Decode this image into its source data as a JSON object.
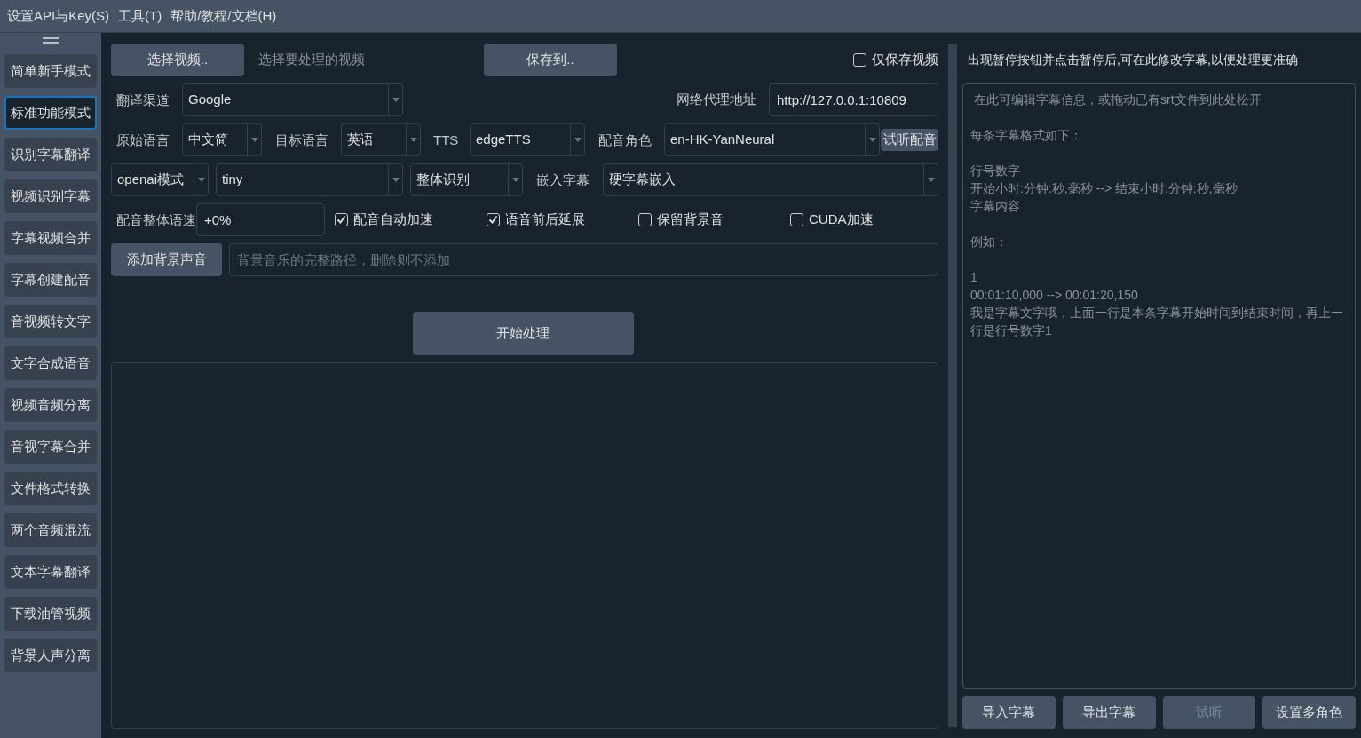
{
  "menu": [
    {
      "label": "设置API与Key(S)"
    },
    {
      "label": "工具(T)"
    },
    {
      "label": "帮助/教程/文档(H)"
    }
  ],
  "sidebar": {
    "items": [
      {
        "label": "简单新手模式",
        "selected": false
      },
      {
        "label": "标准功能模式",
        "selected": true
      },
      {
        "label": "识别字幕翻译",
        "selected": false
      },
      {
        "label": "视频识别字幕",
        "selected": false
      },
      {
        "label": "字幕视频合并",
        "selected": false
      },
      {
        "label": "字幕创建配音",
        "selected": false
      },
      {
        "label": "音视频转文字",
        "selected": false
      },
      {
        "label": "文字合成语音",
        "selected": false
      },
      {
        "label": "视频音频分离",
        "selected": false
      },
      {
        "label": "音视字幕合并",
        "selected": false
      },
      {
        "label": "文件格式转换",
        "selected": false
      },
      {
        "label": "两个音频混流",
        "selected": false
      },
      {
        "label": "文本字幕翻译",
        "selected": false
      },
      {
        "label": "下载油管视频",
        "selected": false
      },
      {
        "label": "背景人声分离",
        "selected": false
      }
    ]
  },
  "main": {
    "select_video_button": "选择视频..",
    "video_hint": "选择要处理的视频",
    "save_to_button": "保存到..",
    "only_save_video": {
      "label": "仅保存视频",
      "checked": false
    },
    "translation_channel": {
      "label": "翻译渠道",
      "value": "Google"
    },
    "proxy": {
      "label": "网络代理地址",
      "value": "http://127.0.0.1:10809"
    },
    "source_language": {
      "label": "原始语言",
      "value": "中文简"
    },
    "target_language": {
      "label": "目标语言",
      "value": "英语"
    },
    "tts": {
      "label": "TTS",
      "value": "edgeTTS"
    },
    "voice_role": {
      "label": "配音角色",
      "value": "en-HK-YanNeural"
    },
    "preview_voice_button": "试听配音",
    "recognition_mode": {
      "value": "openai模式"
    },
    "model": {
      "value": "tiny"
    },
    "recognition_type": {
      "value": "整体识别"
    },
    "embed_subtitle": {
      "label": "嵌入字幕",
      "value": "硬字幕嵌入"
    },
    "speech_rate": {
      "label": "配音整体语速",
      "value": "+0%"
    },
    "options": [
      {
        "label": "配音自动加速",
        "checked": true
      },
      {
        "label": "语音前后延展",
        "checked": true
      },
      {
        "label": "保留背景音",
        "checked": false
      },
      {
        "label": "CUDA加速",
        "checked": false
      }
    ],
    "background_audio": {
      "button": "添加背景声音",
      "placeholder": "背景音乐的完整路径，删除则不添加"
    },
    "start_button": "开始处理"
  },
  "subtitle_panel": {
    "hint": "出现暂停按钮并点击暂停后,可在此修改字幕,以便处理更准确",
    "editor_placeholder": [
      [
        "在此可编辑字幕信息，或拖动已有srt文件到此处松开"
      ],
      [
        "每条字幕格式如下："
      ],
      [
        "行号数字",
        "开始小时:分钟:秒,毫秒 --> 结束小时:分钟:秒,毫秒",
        "字幕内容"
      ],
      [
        "例如："
      ],
      [
        "1",
        "00:01:10,000 --> 00:01:20,150",
        "我是字幕文字哦，上面一行是本条字幕开始时间到结束时间，再上一行是行号数字1"
      ]
    ],
    "buttons": [
      {
        "label": "导入字幕",
        "disabled": false
      },
      {
        "label": "导出字幕",
        "disabled": false
      },
      {
        "label": "试听",
        "disabled": true
      },
      {
        "label": "设置多角色",
        "disabled": false
      }
    ]
  }
}
